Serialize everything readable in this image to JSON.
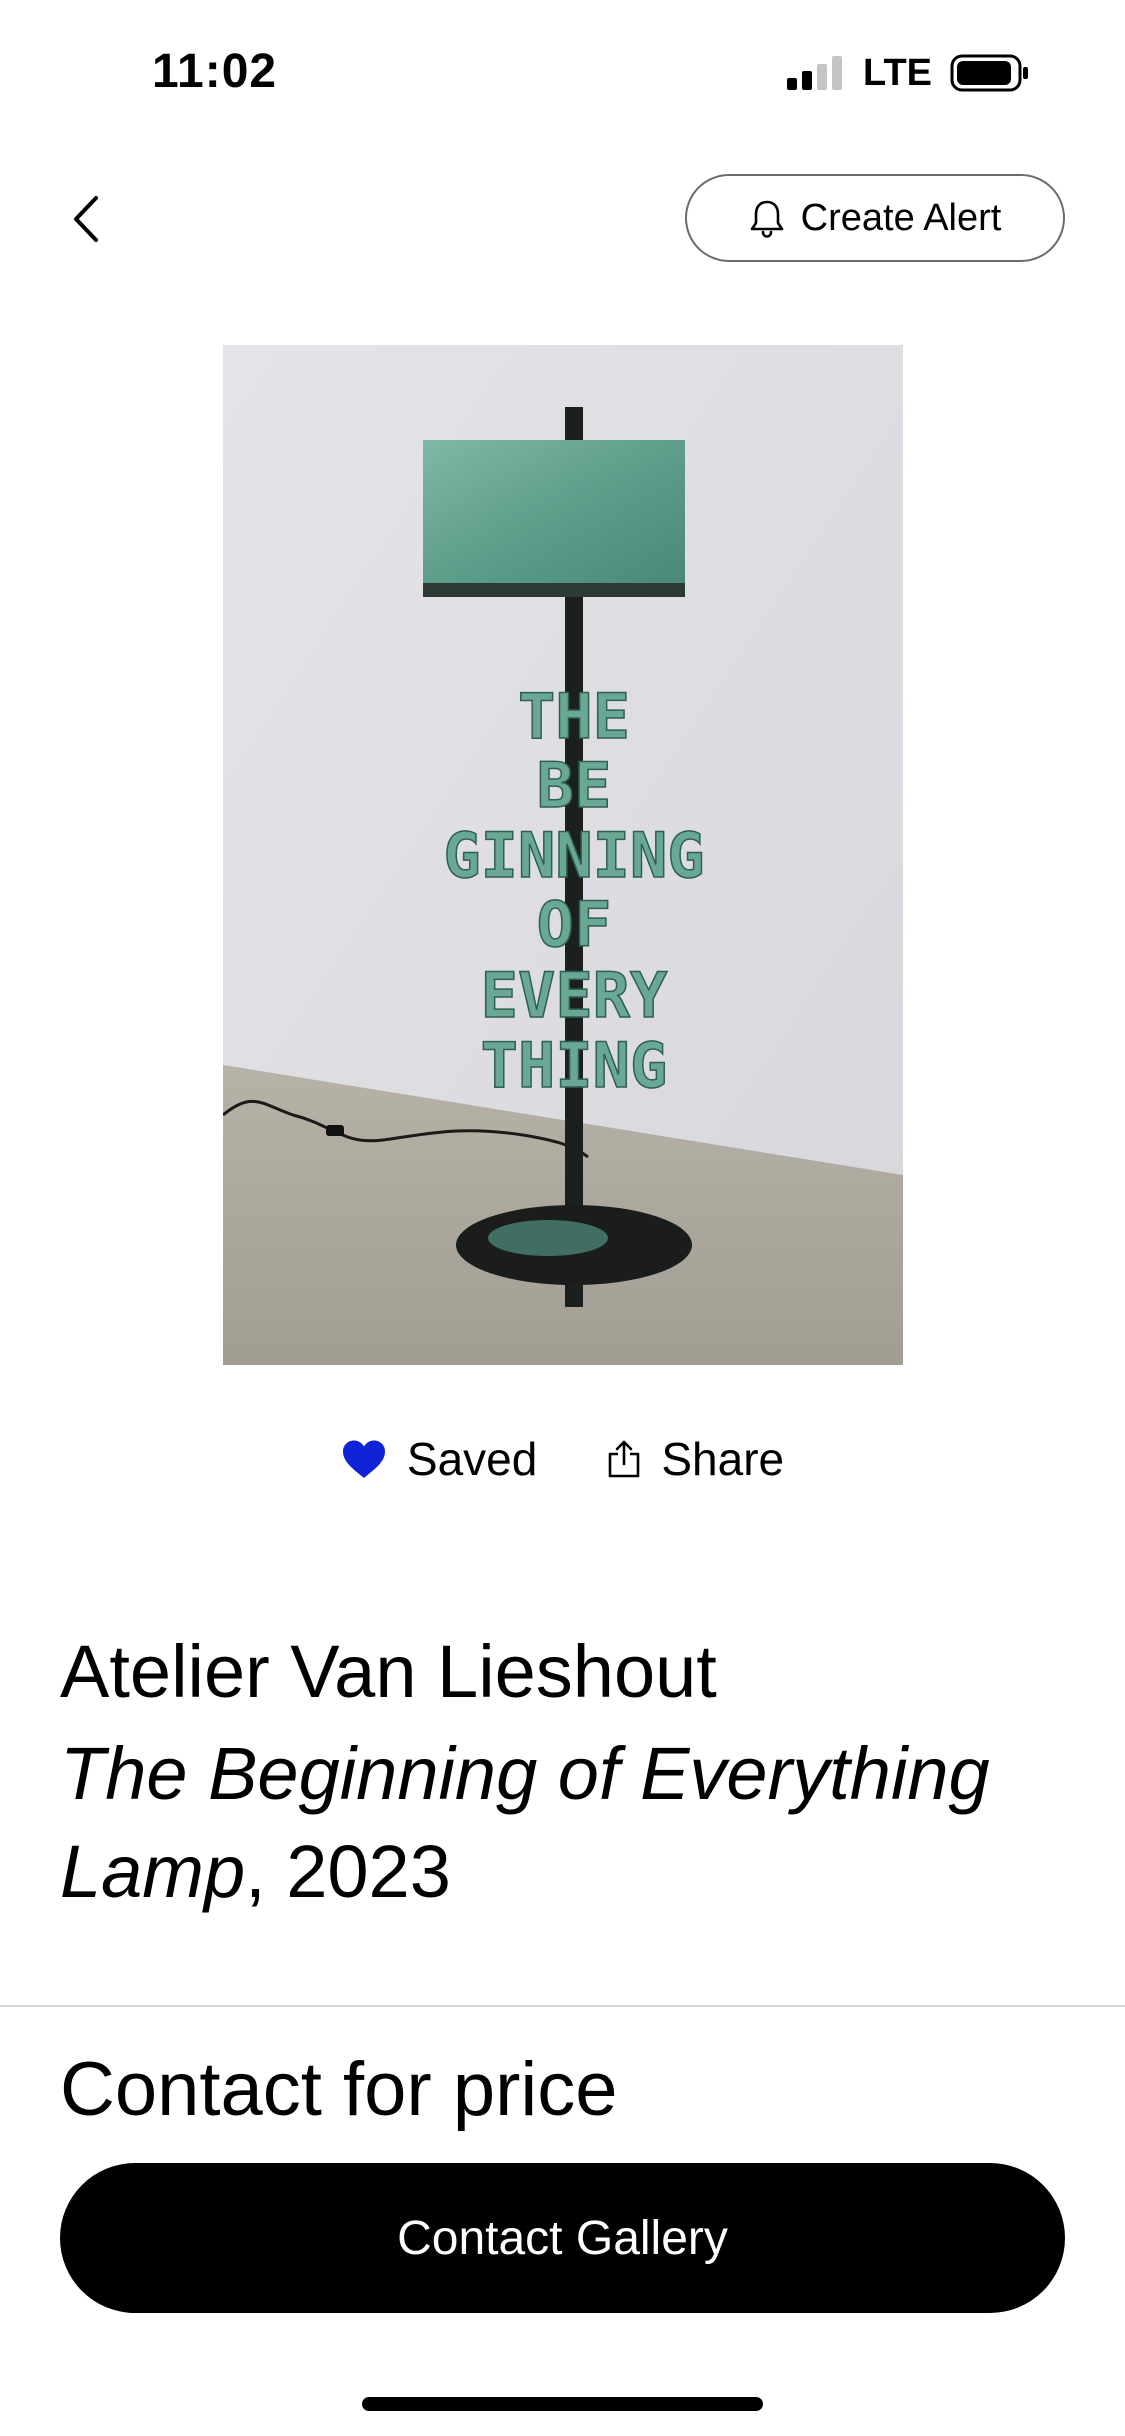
{
  "status_bar": {
    "time": "11:02",
    "network": "LTE"
  },
  "header": {
    "back_icon": "chevron-left-icon",
    "create_alert_icon": "bell-icon",
    "create_alert_label": "Create Alert"
  },
  "artwork_image": {
    "depicted_text": [
      "THE",
      "BE",
      "GINNING",
      "OF",
      "EVERY",
      "THING"
    ]
  },
  "actions": {
    "saved_label": "Saved",
    "saved_icon": "heart-icon",
    "saved_color": "#1023d7",
    "share_label": "Share",
    "share_icon": "share-icon"
  },
  "details": {
    "artist": "Atelier Van Lieshout",
    "title": "The Beginning of Everything Lamp",
    "year": "2023",
    "price": "Contact for price"
  },
  "cta": {
    "label": "Contact Gallery"
  }
}
